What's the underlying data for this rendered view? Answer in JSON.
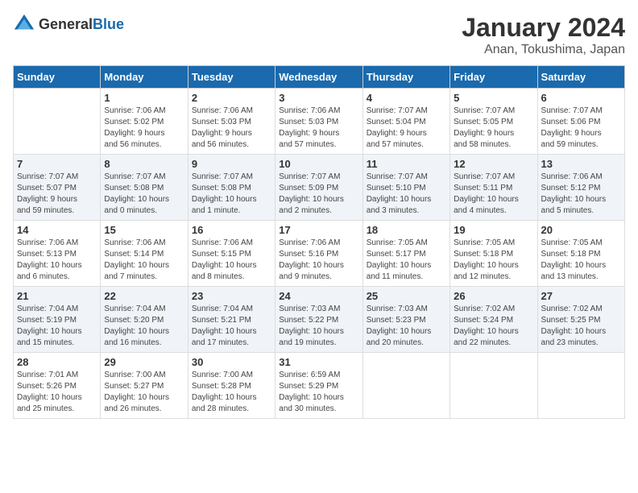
{
  "header": {
    "logo_general": "General",
    "logo_blue": "Blue",
    "month_title": "January 2024",
    "location": "Anan, Tokushima, Japan"
  },
  "days_of_week": [
    "Sunday",
    "Monday",
    "Tuesday",
    "Wednesday",
    "Thursday",
    "Friday",
    "Saturday"
  ],
  "weeks": [
    {
      "days": [
        {
          "number": "",
          "info": ""
        },
        {
          "number": "1",
          "info": "Sunrise: 7:06 AM\nSunset: 5:02 PM\nDaylight: 9 hours\nand 56 minutes."
        },
        {
          "number": "2",
          "info": "Sunrise: 7:06 AM\nSunset: 5:03 PM\nDaylight: 9 hours\nand 56 minutes."
        },
        {
          "number": "3",
          "info": "Sunrise: 7:06 AM\nSunset: 5:03 PM\nDaylight: 9 hours\nand 57 minutes."
        },
        {
          "number": "4",
          "info": "Sunrise: 7:07 AM\nSunset: 5:04 PM\nDaylight: 9 hours\nand 57 minutes."
        },
        {
          "number": "5",
          "info": "Sunrise: 7:07 AM\nSunset: 5:05 PM\nDaylight: 9 hours\nand 58 minutes."
        },
        {
          "number": "6",
          "info": "Sunrise: 7:07 AM\nSunset: 5:06 PM\nDaylight: 9 hours\nand 59 minutes."
        }
      ]
    },
    {
      "days": [
        {
          "number": "7",
          "info": "Sunrise: 7:07 AM\nSunset: 5:07 PM\nDaylight: 9 hours\nand 59 minutes."
        },
        {
          "number": "8",
          "info": "Sunrise: 7:07 AM\nSunset: 5:08 PM\nDaylight: 10 hours\nand 0 minutes."
        },
        {
          "number": "9",
          "info": "Sunrise: 7:07 AM\nSunset: 5:08 PM\nDaylight: 10 hours\nand 1 minute."
        },
        {
          "number": "10",
          "info": "Sunrise: 7:07 AM\nSunset: 5:09 PM\nDaylight: 10 hours\nand 2 minutes."
        },
        {
          "number": "11",
          "info": "Sunrise: 7:07 AM\nSunset: 5:10 PM\nDaylight: 10 hours\nand 3 minutes."
        },
        {
          "number": "12",
          "info": "Sunrise: 7:07 AM\nSunset: 5:11 PM\nDaylight: 10 hours\nand 4 minutes."
        },
        {
          "number": "13",
          "info": "Sunrise: 7:06 AM\nSunset: 5:12 PM\nDaylight: 10 hours\nand 5 minutes."
        }
      ]
    },
    {
      "days": [
        {
          "number": "14",
          "info": "Sunrise: 7:06 AM\nSunset: 5:13 PM\nDaylight: 10 hours\nand 6 minutes."
        },
        {
          "number": "15",
          "info": "Sunrise: 7:06 AM\nSunset: 5:14 PM\nDaylight: 10 hours\nand 7 minutes."
        },
        {
          "number": "16",
          "info": "Sunrise: 7:06 AM\nSunset: 5:15 PM\nDaylight: 10 hours\nand 8 minutes."
        },
        {
          "number": "17",
          "info": "Sunrise: 7:06 AM\nSunset: 5:16 PM\nDaylight: 10 hours\nand 9 minutes."
        },
        {
          "number": "18",
          "info": "Sunrise: 7:05 AM\nSunset: 5:17 PM\nDaylight: 10 hours\nand 11 minutes."
        },
        {
          "number": "19",
          "info": "Sunrise: 7:05 AM\nSunset: 5:18 PM\nDaylight: 10 hours\nand 12 minutes."
        },
        {
          "number": "20",
          "info": "Sunrise: 7:05 AM\nSunset: 5:18 PM\nDaylight: 10 hours\nand 13 minutes."
        }
      ]
    },
    {
      "days": [
        {
          "number": "21",
          "info": "Sunrise: 7:04 AM\nSunset: 5:19 PM\nDaylight: 10 hours\nand 15 minutes."
        },
        {
          "number": "22",
          "info": "Sunrise: 7:04 AM\nSunset: 5:20 PM\nDaylight: 10 hours\nand 16 minutes."
        },
        {
          "number": "23",
          "info": "Sunrise: 7:04 AM\nSunset: 5:21 PM\nDaylight: 10 hours\nand 17 minutes."
        },
        {
          "number": "24",
          "info": "Sunrise: 7:03 AM\nSunset: 5:22 PM\nDaylight: 10 hours\nand 19 minutes."
        },
        {
          "number": "25",
          "info": "Sunrise: 7:03 AM\nSunset: 5:23 PM\nDaylight: 10 hours\nand 20 minutes."
        },
        {
          "number": "26",
          "info": "Sunrise: 7:02 AM\nSunset: 5:24 PM\nDaylight: 10 hours\nand 22 minutes."
        },
        {
          "number": "27",
          "info": "Sunrise: 7:02 AM\nSunset: 5:25 PM\nDaylight: 10 hours\nand 23 minutes."
        }
      ]
    },
    {
      "days": [
        {
          "number": "28",
          "info": "Sunrise: 7:01 AM\nSunset: 5:26 PM\nDaylight: 10 hours\nand 25 minutes."
        },
        {
          "number": "29",
          "info": "Sunrise: 7:00 AM\nSunset: 5:27 PM\nDaylight: 10 hours\nand 26 minutes."
        },
        {
          "number": "30",
          "info": "Sunrise: 7:00 AM\nSunset: 5:28 PM\nDaylight: 10 hours\nand 28 minutes."
        },
        {
          "number": "31",
          "info": "Sunrise: 6:59 AM\nSunset: 5:29 PM\nDaylight: 10 hours\nand 30 minutes."
        },
        {
          "number": "",
          "info": ""
        },
        {
          "number": "",
          "info": ""
        },
        {
          "number": "",
          "info": ""
        }
      ]
    }
  ]
}
